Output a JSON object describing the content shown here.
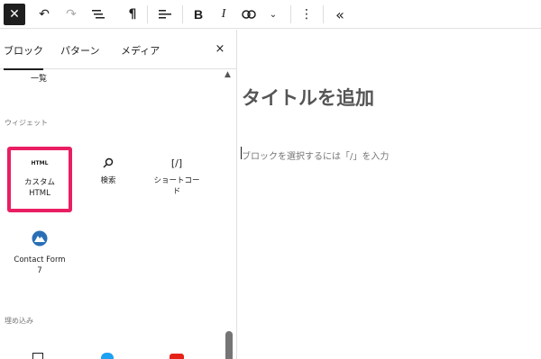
{
  "toolbar": {
    "close_icon": "close-icon",
    "undo_icon": "undo-icon",
    "redo_icon": "redo-icon",
    "list_view_icon": "list-view-icon",
    "paragraph_icon": "paragraph-icon",
    "align_icon": "align-icon",
    "bold": "B",
    "italic": "I",
    "link_icon": "link-icon",
    "more_rich_icon": "chevron-down-icon",
    "options_icon": "more-vertical-icon",
    "collapse_icon": "chevron-double-left-icon"
  },
  "sidebar": {
    "tabs": [
      {
        "label": "ブロック"
      },
      {
        "label": "パターン"
      },
      {
        "label": "メディア"
      }
    ],
    "close": "×",
    "partial_item_label": "一覧",
    "widgets_title": "ウィジェット",
    "widgets": [
      {
        "icon_text": "HTML",
        "label_line1": "カスタム",
        "label_line2": "HTML"
      },
      {
        "icon_text": "⌕",
        "label_line1": "検索",
        "label_line2": ""
      },
      {
        "icon_text": "[/]",
        "label_line1": "ショートコー",
        "label_line2": "ド"
      },
      {
        "icon_text": "",
        "label_line1": "Contact Form",
        "label_line2": "7"
      }
    ],
    "embeds_title": "埋め込み"
  },
  "editor": {
    "title_placeholder": "タイトルを追加",
    "block_placeholder": "ブロックを選択するには「/」を入力"
  },
  "colors": {
    "highlight": "#e91e63",
    "contact_form_icon": "#2a6fb5"
  }
}
